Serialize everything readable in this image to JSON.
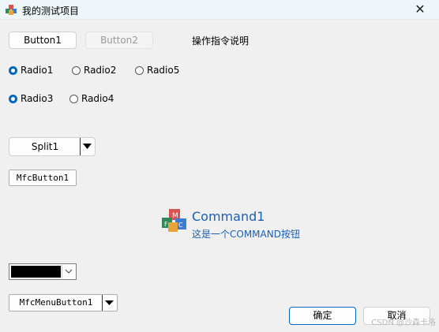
{
  "window": {
    "title": "我的测试项目",
    "close_glyph": "✕"
  },
  "buttons": {
    "button1": "Button1",
    "button2": "Button2",
    "instructions": "操作指令说明",
    "split1": "Split1",
    "mfc_button1": "MfcButton1",
    "mfc_menu_button1": "MfcMenuButton1",
    "ok": "确定",
    "cancel": "取消"
  },
  "radios": [
    {
      "label": "Radio1",
      "checked": true
    },
    {
      "label": "Radio2",
      "checked": false
    },
    {
      "label": "Radio5",
      "checked": false
    },
    {
      "label": "Radio3",
      "checked": true
    },
    {
      "label": "Radio4",
      "checked": false
    }
  ],
  "command_link": {
    "title": "Command1",
    "description": "这是一个COMMAND按钮",
    "icon": "mfc-cubes-icon"
  },
  "color_picker": {
    "selected_color": "#000000"
  },
  "watermark": "CSDN @沙森卡洛",
  "colors": {
    "accent": "#0067c0",
    "link": "#1a5fb4",
    "window_bg": "#f0f0f0"
  }
}
